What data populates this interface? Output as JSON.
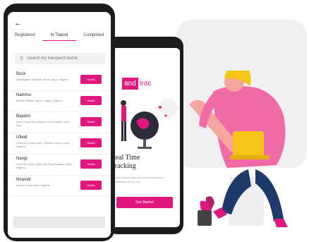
{
  "colors": {
    "accent": "#e0177f",
    "phone_body": "#1c1c1e"
  },
  "front_phone": {
    "back_icon": "arrow-left-icon",
    "tabs": [
      {
        "label": "Registered",
        "active": false
      },
      {
        "label": "In Transit",
        "active": true
      },
      {
        "label": "Completed",
        "active": false
      }
    ],
    "search": {
      "placeholder": "Search By Recipient Name",
      "icon": "search-icon"
    },
    "items": [
      {
        "name": "Buck",
        "address": "Reddington Hospital, Ikeja Lagos, Nigeria",
        "action": "Details"
      },
      {
        "name": "Nammu",
        "address": "Ifinade Bridge Lagos, Lagos, Nigeria",
        "action": "Details"
      },
      {
        "name": "Bayemi",
        "address": "Ikeja Local Development Secretariat Lekki - Epe",
        "action": "Details"
      },
      {
        "name": "Ufiedi",
        "address": "Chevron Drive Lekki, Chevron Drive, Lekki, Nigeria",
        "action": "Details"
      },
      {
        "name": "Nangi",
        "address": "Auto Bus Stop Lekki-Epe Expressway, Lekki, Nigeria",
        "action": "Details"
      },
      {
        "name": "Nnamdi",
        "address": "Assam Road Ikeja, Nigeria",
        "action": "Details"
      }
    ]
  },
  "back_phone": {
    "brand_box": "and",
    "brand_text": "trac",
    "title_line1": "Real Time",
    "title_line2": "Tracking",
    "subtitle": "Lorem ipsum dolor sit amet consectetur adipiscing elit sed do",
    "button": "Get Started"
  }
}
